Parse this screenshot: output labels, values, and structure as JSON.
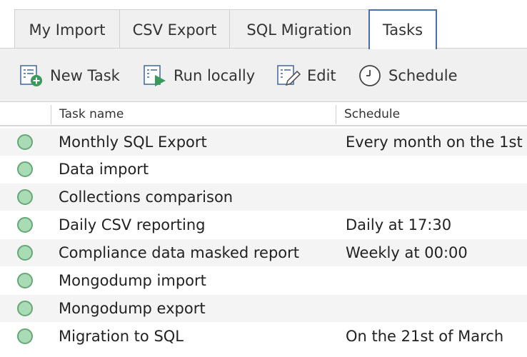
{
  "tabs": [
    {
      "label": "My Import"
    },
    {
      "label": "CSV Export"
    },
    {
      "label": "SQL Migration"
    },
    {
      "label": "Tasks"
    }
  ],
  "toolbar": {
    "new_task": {
      "label": "New Task",
      "icon": "new-task-icon"
    },
    "run_locally": {
      "label": "Run locally",
      "icon": "run-icon"
    },
    "edit": {
      "label": "Edit",
      "icon": "edit-icon"
    },
    "schedule": {
      "label": "Schedule",
      "icon": "clock-icon"
    }
  },
  "table": {
    "columns": [
      "Task name",
      "Schedule"
    ],
    "rows": [
      {
        "name": "Monthly SQL Export",
        "schedule": "Every month on the 1st"
      },
      {
        "name": "Data import",
        "schedule": ""
      },
      {
        "name": "Collections comparison",
        "schedule": ""
      },
      {
        "name": "Daily CSV reporting",
        "schedule": "Daily at 17:30"
      },
      {
        "name": "Compliance data masked report",
        "schedule": "Weekly at 00:00"
      },
      {
        "name": "Mongodump import",
        "schedule": ""
      },
      {
        "name": "Mongodump export",
        "schedule": ""
      },
      {
        "name": "Migration to SQL",
        "schedule": "On the 21st of March"
      }
    ]
  },
  "colors": {
    "status_dot": "#a9dbb5",
    "active_tab_border": "#4a6fa5"
  }
}
